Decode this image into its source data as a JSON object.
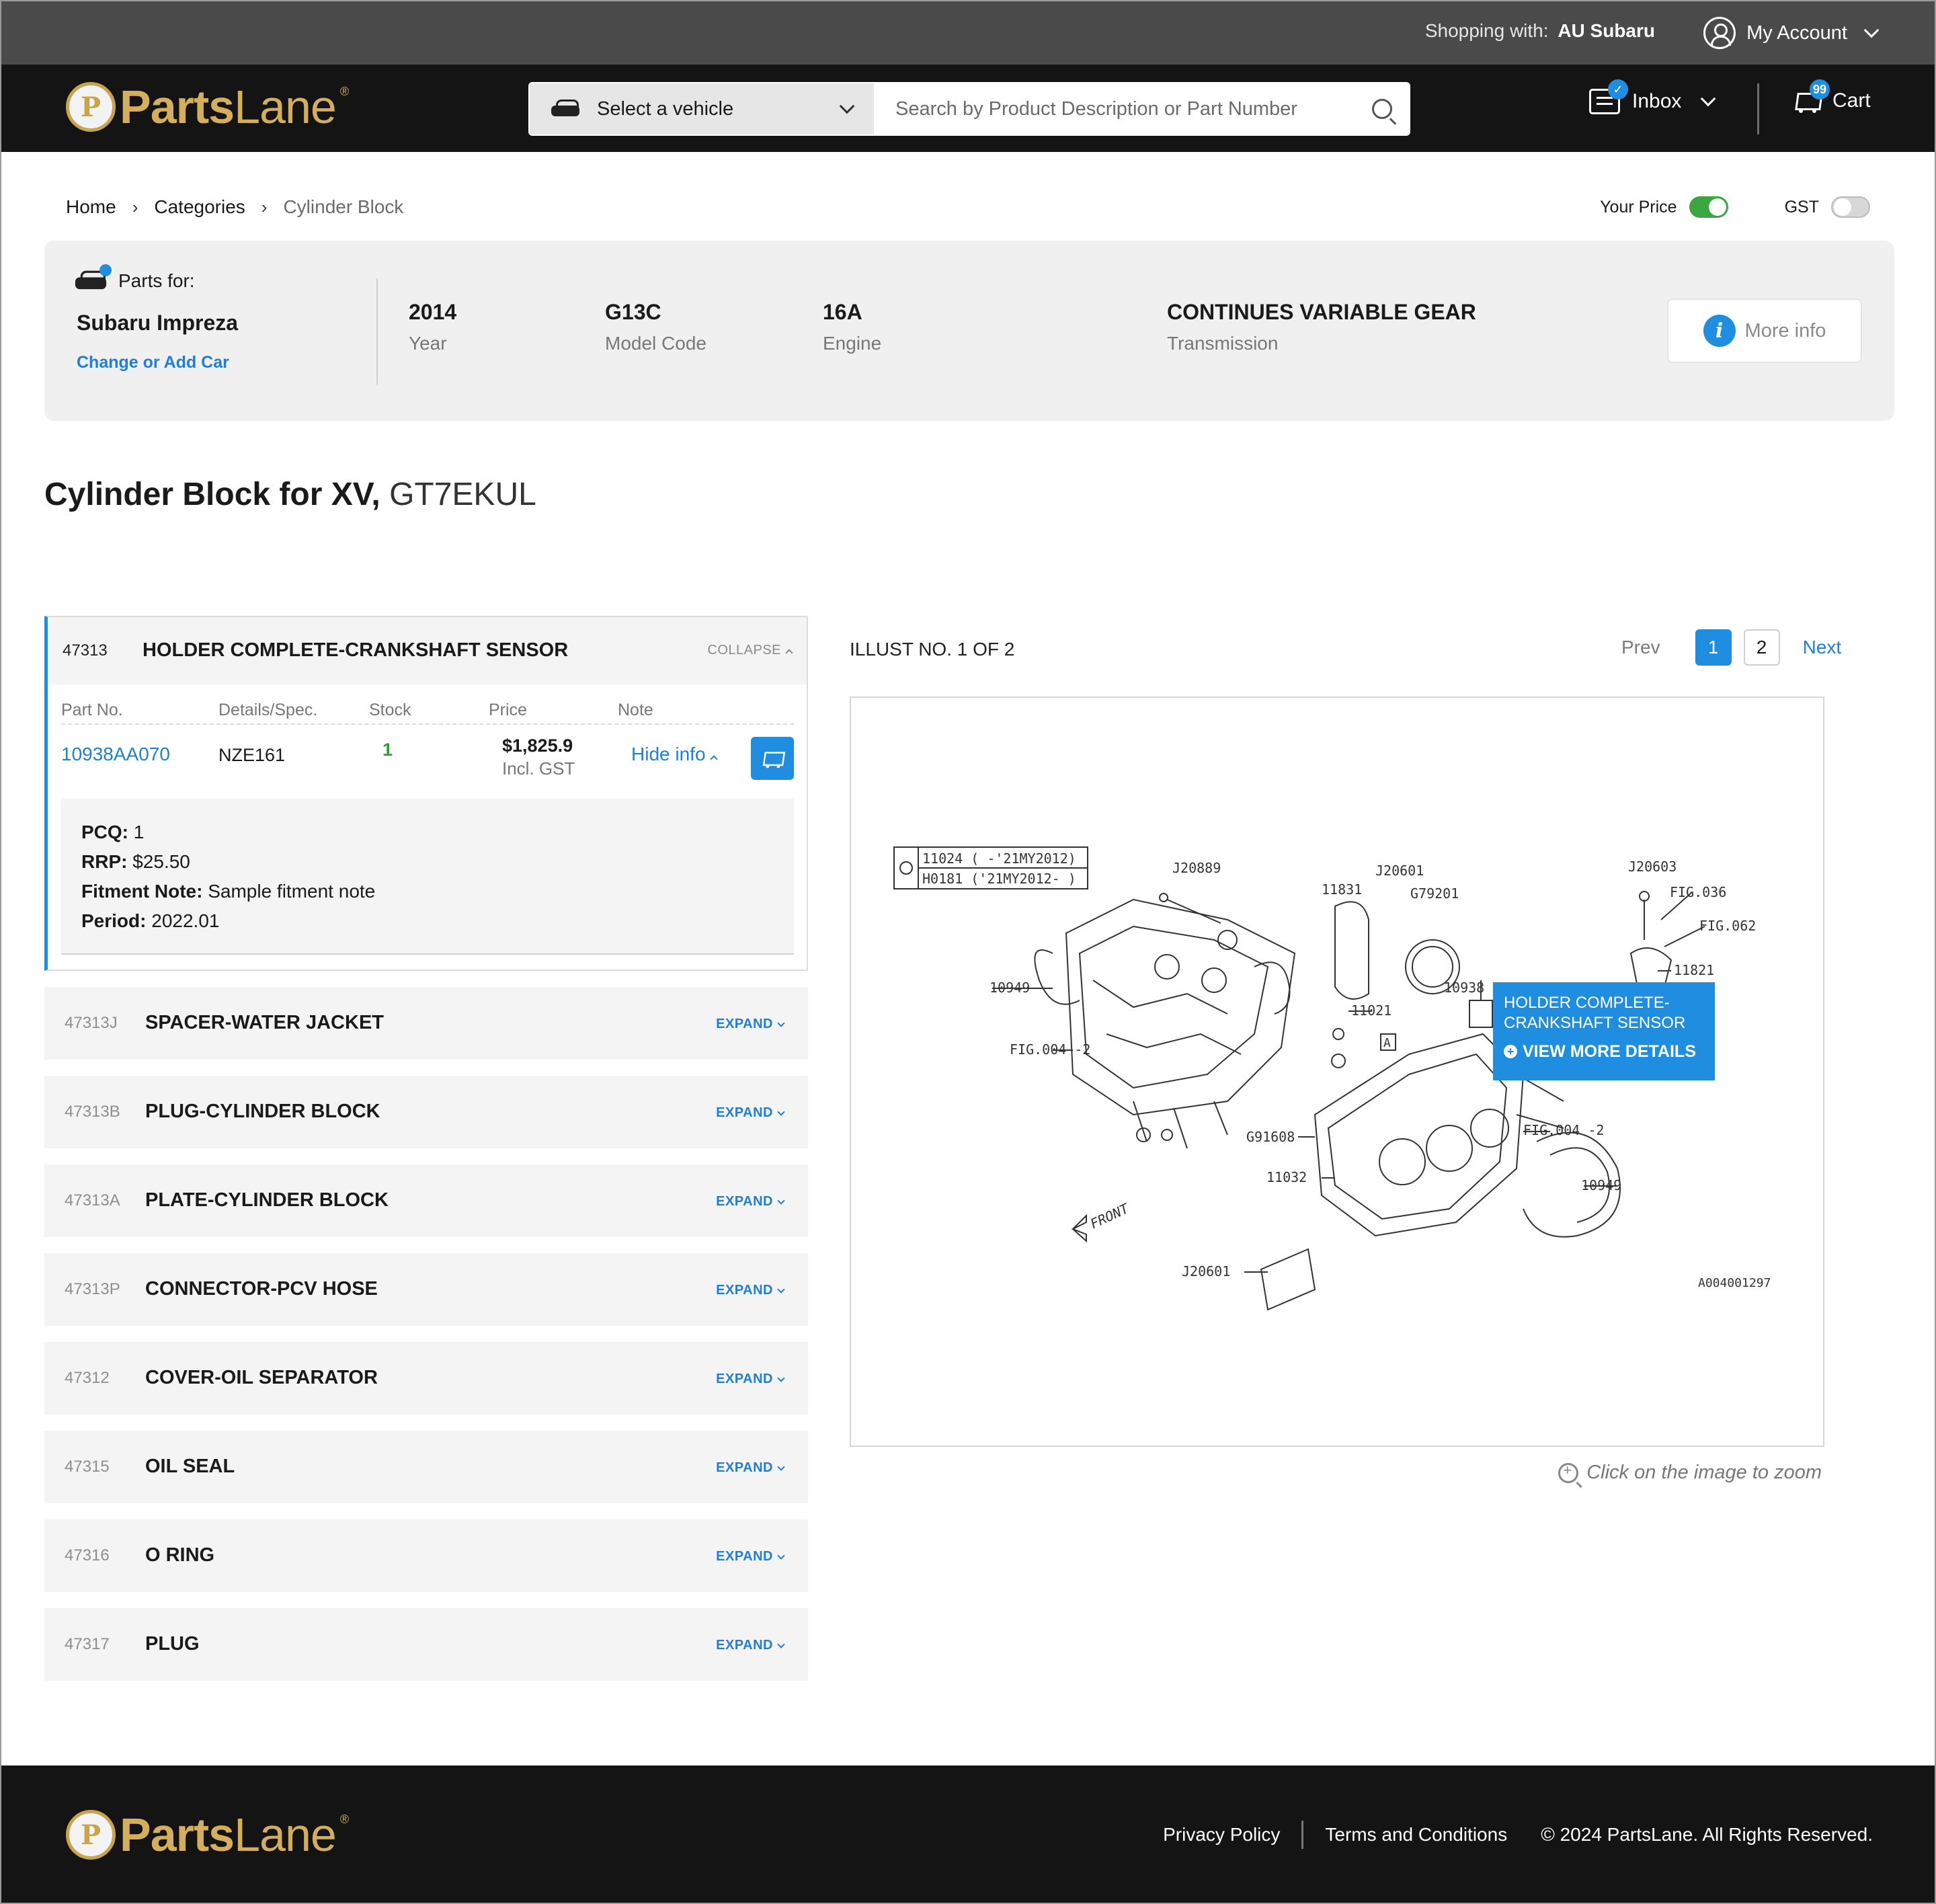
{
  "topbar": {
    "shopping_label": "Shopping with:",
    "shopping_store": "AU Subaru",
    "account_label": "My Account"
  },
  "header": {
    "logo_main": "Parts",
    "logo_accent": "Lane",
    "vehicle_select_label": "Select a vehicle",
    "search_placeholder": "Search by Product Description or Part Number",
    "inbox_label": "Inbox",
    "cart_label": "Cart",
    "cart_count": "99"
  },
  "breadcrumb": {
    "home": "Home",
    "categories": "Categories",
    "current": "Cylinder Block"
  },
  "toggles": {
    "your_price_label": "Your Price",
    "your_price_on": true,
    "gst_label": "GST",
    "gst_on": false
  },
  "vehicle": {
    "parts_for_label": "Parts for:",
    "model": "Subaru Impreza",
    "change_link": "Change or Add Car",
    "specs": [
      {
        "value": "2014",
        "label": "Year"
      },
      {
        "value": "G13C",
        "label": "Model Code"
      },
      {
        "value": "16A",
        "label": "Engine"
      },
      {
        "value": "CONTINUES VARIABLE GEAR",
        "label": "Transmission"
      }
    ],
    "more_info": "More info"
  },
  "page": {
    "title_bold": "Cylinder Block for XV,",
    "title_rest": "GT7EKUL"
  },
  "open_part": {
    "code": "47313",
    "name": "HOLDER COMPLETE-CRANKSHAFT SENSOR",
    "collapse_label": "COLLAPSE",
    "columns": [
      "Part No.",
      "Details/Spec.",
      "Stock",
      "Price",
      "Note"
    ],
    "row": {
      "part_no": "10938AA070",
      "spec": "NZE161",
      "stock": "1",
      "price": "$1,825.9",
      "price_note": "Incl. GST",
      "note_link": "Hide info"
    },
    "details": [
      {
        "label": "PCQ:",
        "value": "1"
      },
      {
        "label": "RRP:",
        "value": "$25.50"
      },
      {
        "label": "Fitment Note:",
        "value": "Sample fitment note"
      },
      {
        "label": "Period:",
        "value": "2022.01"
      }
    ]
  },
  "parts": [
    {
      "code": "47313J",
      "name": "SPACER-WATER JACKET",
      "action": "EXPAND"
    },
    {
      "code": "47313B",
      "name": "PLUG-CYLINDER BLOCK",
      "action": "EXPAND"
    },
    {
      "code": "47313A",
      "name": "PLATE-CYLINDER BLOCK",
      "action": "EXPAND"
    },
    {
      "code": "47313P",
      "name": "CONNECTOR-PCV HOSE",
      "action": "EXPAND"
    },
    {
      "code": "47312",
      "name": "COVER-OIL SEPARATOR",
      "action": "EXPAND"
    },
    {
      "code": "47315",
      "name": "OIL SEAL",
      "action": "EXPAND"
    },
    {
      "code": "47316",
      "name": "O RING",
      "action": "EXPAND"
    },
    {
      "code": "47317",
      "name": "PLUG",
      "action": "EXPAND"
    }
  ],
  "illustration": {
    "label": "ILLUST NO. 1 OF 2",
    "prev": "Prev",
    "pages": [
      "1",
      "2"
    ],
    "next": "Next",
    "tooltip_title": "HOLDER COMPLETE-CRANKSHAFT SENSOR",
    "tooltip_action": "VIEW MORE DETAILS",
    "zoom_hint": "Click on the image to zoom",
    "callouts": {
      "ref_1": "11024 ( -'21MY2012)",
      "ref_2": "H0181 ('21MY2012- )",
      "c1": "J20889",
      "c2": "11831",
      "c3": "J20601",
      "c4": "G79201",
      "c5": "J20603",
      "c6": "FIG.036",
      "c7": "FIG.062",
      "c8": "11821",
      "c9": "10949",
      "c10": "10938",
      "c11": "11021",
      "c12": "FIG.004 -2",
      "c13": "G91608",
      "c14": "FIG.004 -2",
      "c15": "11032",
      "c16": "10949",
      "c17": "J20601",
      "c18": "FRONT",
      "c19": "A004001297",
      "c20": "A"
    }
  },
  "footer": {
    "logo_main": "Parts",
    "logo_accent": "Lane",
    "privacy": "Privacy Policy",
    "terms": "Terms and Conditions",
    "copyright": "© 2024 PartsLane. All Rights Reserved."
  },
  "colors": {
    "accent": "#1f8ee0",
    "gold": "#d4ae5c",
    "stock_green": "#2aa233",
    "header_bg": "#141414",
    "topbar_bg": "#4a4a4a"
  }
}
